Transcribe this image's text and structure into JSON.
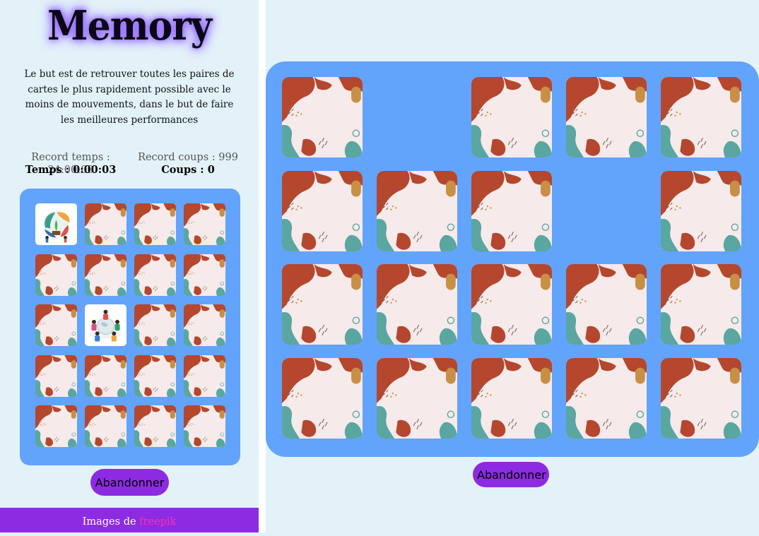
{
  "app": {
    "title": "Memory",
    "description": "Le but est de retrouver toutes les paires de cartes le plus rapidement possible avec le moins de mouvements, dans le but de faire les meilleures performances"
  },
  "stats": {
    "record_time": "Record temps : 24:00:00",
    "record_moves": "Record coups : 999",
    "time": "Temps : 0:00:03",
    "moves": "Coups : 0"
  },
  "small_board": {
    "columns": 4,
    "rows": 5,
    "cards": [
      {
        "state": "revealed",
        "picture": "plant-charity-illustration"
      },
      {
        "state": "hidden"
      },
      {
        "state": "hidden"
      },
      {
        "state": "hidden"
      },
      {
        "state": "hidden"
      },
      {
        "state": "hidden"
      },
      {
        "state": "hidden"
      },
      {
        "state": "hidden"
      },
      {
        "state": "hidden"
      },
      {
        "state": "revealed",
        "picture": "people-around-globe-illustration"
      },
      {
        "state": "hidden"
      },
      {
        "state": "hidden"
      },
      {
        "state": "hidden"
      },
      {
        "state": "hidden"
      },
      {
        "state": "hidden"
      },
      {
        "state": "hidden"
      },
      {
        "state": "hidden"
      },
      {
        "state": "hidden"
      },
      {
        "state": "hidden"
      },
      {
        "state": "hidden"
      }
    ]
  },
  "big_board": {
    "columns": 5,
    "rows": 4,
    "cards": [
      {
        "state": "hidden"
      },
      {
        "state": "matched"
      },
      {
        "state": "hidden"
      },
      {
        "state": "hidden"
      },
      {
        "state": "hidden"
      },
      {
        "state": "hidden"
      },
      {
        "state": "hidden"
      },
      {
        "state": "hidden"
      },
      {
        "state": "matched"
      },
      {
        "state": "hidden"
      },
      {
        "state": "hidden"
      },
      {
        "state": "hidden"
      },
      {
        "state": "hidden"
      },
      {
        "state": "hidden"
      },
      {
        "state": "hidden"
      },
      {
        "state": "hidden"
      },
      {
        "state": "hidden"
      },
      {
        "state": "hidden"
      },
      {
        "state": "hidden"
      },
      {
        "state": "hidden"
      }
    ]
  },
  "buttons": {
    "abandon_label": "Abandonner"
  },
  "footer": {
    "credit_prefix": "Images de",
    "credit_link": "freepik"
  },
  "colors": {
    "background": "#e3f2f9",
    "board": "#62a3fb",
    "accent": "#8d2be2",
    "link": "#ff2fa8",
    "card_face": "#f6eaea",
    "card_rust": "#b4472d",
    "card_teal": "#5aa6a0",
    "card_mustard": "#c98f45"
  }
}
